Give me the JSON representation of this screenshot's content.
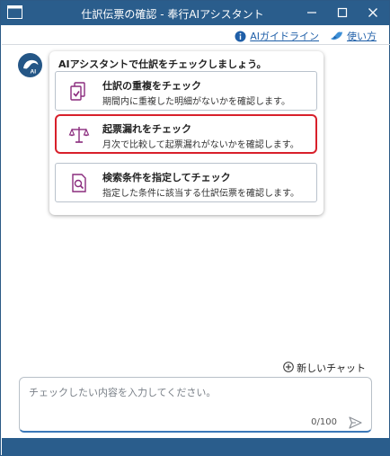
{
  "window": {
    "title": "仕訳伝票の確認 - 奉行AIアシスタント"
  },
  "links": {
    "guideline": "AIガイドライン",
    "help": "使い方"
  },
  "assistant": {
    "avatar_text": "AI"
  },
  "card": {
    "heading": "AIアシスタントで仕訳をチェックしましょう。",
    "options": [
      {
        "title": "仕訳の重複をチェック",
        "desc": "期間内に重複した明細がないかを確認します。",
        "icon": "duplicate-document-check-icon",
        "selected": false
      },
      {
        "title": "起票漏れをチェック",
        "desc": "月次で比較して起票漏れがないかを確認します。",
        "icon": "balance-scale-icon",
        "selected": true
      },
      {
        "title": "検索条件を指定してチェック",
        "desc": "指定した条件に該当する仕訳伝票を確認します。",
        "icon": "document-search-icon",
        "selected": false
      }
    ]
  },
  "chat": {
    "new_chat_label": "新しいチャット",
    "input_placeholder": "チェックしたい内容を入力してください。",
    "char_count": "0/100"
  },
  "colors": {
    "titlebar": "#2a5d8c",
    "accent_purple": "#8a2b7d",
    "selected_border": "#d8202b",
    "link": "#1f5fa8"
  }
}
